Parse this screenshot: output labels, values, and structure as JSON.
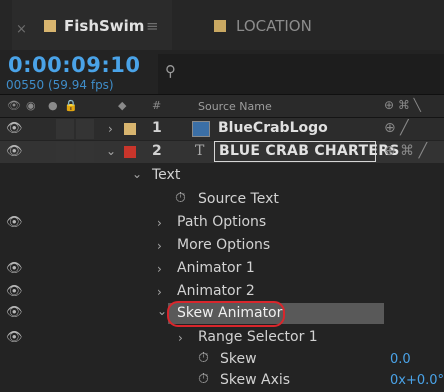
{
  "tabs": {
    "active": {
      "name": "FishSwim",
      "color": "#d8b56f"
    },
    "inactive": {
      "name": "LOCATION",
      "color": "#c9a862"
    }
  },
  "composition": {
    "timecode": "0:00:09:10",
    "frame_info": "00550 (59.94 fps)"
  },
  "search": {
    "placeholder": ""
  },
  "columns": {
    "hash": "#",
    "source_name": "Source Name"
  },
  "layers": [
    {
      "index": "1",
      "name": "BlueCrabLogo",
      "type": "footage",
      "label_color": "#d8b56f"
    },
    {
      "index": "2",
      "name": "BLUE CRAB CHARTERS",
      "type": "text",
      "type_glyph": "T",
      "label_color": "#c8352b"
    }
  ],
  "properties": {
    "text": "Text",
    "source_text": "Source Text",
    "path_options": "Path Options",
    "more_options": "More Options",
    "animator1": "Animator 1",
    "animator2": "Animator 2",
    "skew_animator": "Skew Animator",
    "range_selector": "Range Selector 1",
    "skew": "Skew",
    "skew_value": "0.0",
    "skew_axis": "Skew Axis",
    "skew_axis_value": "0x+0.0°"
  },
  "colors": {
    "accent": "#4aa3e8",
    "highlight_circle": "#d9262c",
    "selected_row": "#595959"
  }
}
